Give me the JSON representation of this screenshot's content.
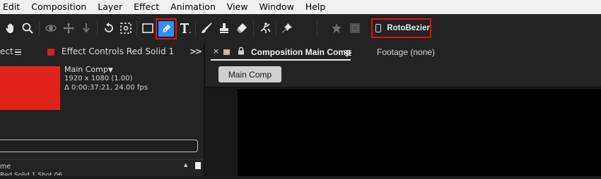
{
  "menubar": {
    "items": [
      "Edit",
      "Composition",
      "Layer",
      "Effect",
      "Animation",
      "View",
      "Window",
      "Help"
    ]
  },
  "toolbar": {
    "tools": [
      "hand-icon",
      "zoom-icon",
      "orbit-camera-icon",
      "pan-camera-icon",
      "dolly-camera-icon",
      "rotate-icon",
      "pan-behind-icon",
      "rectangle-icon",
      "pen-icon",
      "text-icon",
      "brush-icon",
      "clone-stamp-icon",
      "eraser-icon",
      "roto-brush-icon",
      "puppet-pin-icon",
      "star-icon",
      "snapping-icon"
    ],
    "active_tool": "pen-icon",
    "active_color": "#2a8fff",
    "roto_bezier_label": "RotoBezier",
    "roto_bezier_checked": false
  },
  "left_panel": {
    "project_tab": "ect",
    "effect_controls_tab": "Effect Controls Red Solid 1",
    "swatch_color": "#c6232a",
    "comp_name": "Main Comp",
    "comp_resolution": "1920 x 1080 (1.00)",
    "comp_duration": "Δ 0:00:37:21, 24.00 fps",
    "search_placeholder": "",
    "name_header": "me",
    "first_item": "Red Solid 1 Shot 06"
  },
  "right_panel": {
    "comp_tab_label": "Composition Main Comp",
    "footage_tab_label": "Footage (none)",
    "breadcrumb": "Main Comp"
  }
}
